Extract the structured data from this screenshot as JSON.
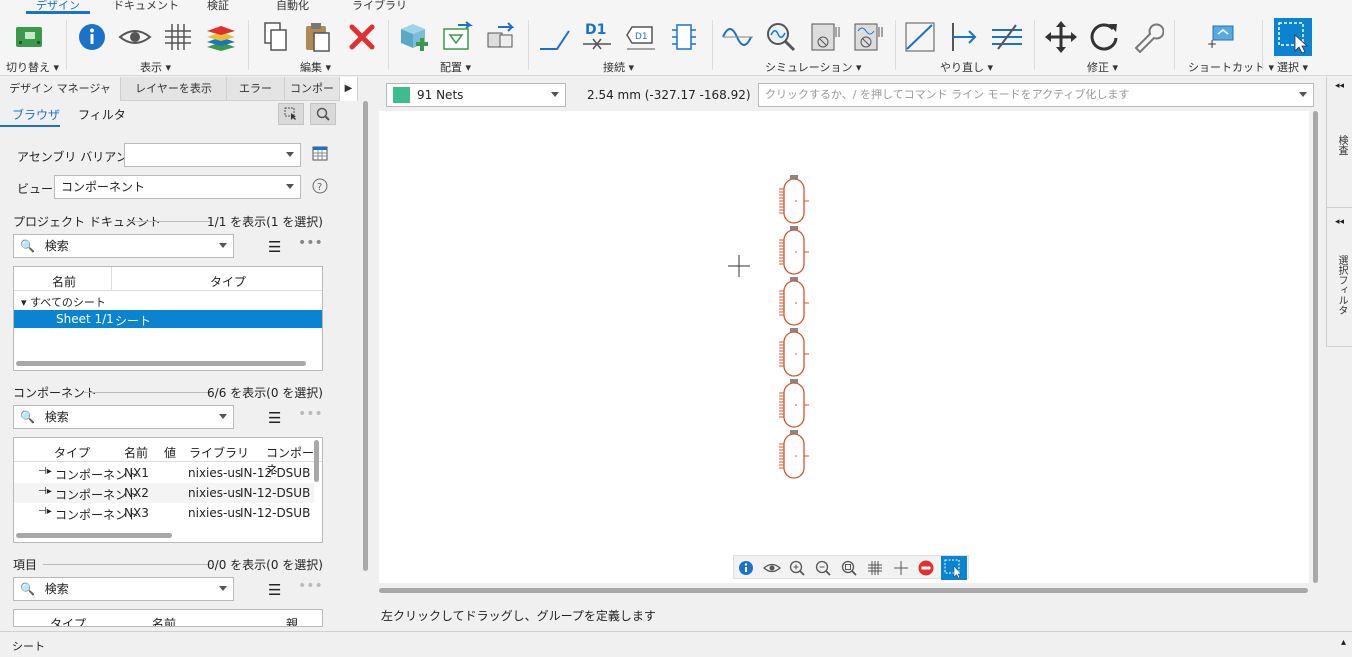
{
  "menu": {
    "tabs": [
      {
        "label": "デザイン",
        "active": true
      },
      {
        "label": "ドキュメント",
        "active": false
      },
      {
        "label": "検証",
        "active": false
      },
      {
        "label": "自動化",
        "active": false
      },
      {
        "label": "ライブラリ",
        "active": false
      }
    ]
  },
  "ribbon": {
    "groups": {
      "switch": "切り替え",
      "view": "表示",
      "edit": "編集",
      "place": "配置",
      "connect": "接続",
      "simulation": "シミュレーション",
      "undo": "やり直し",
      "modify": "修正",
      "shortcut": "ショートカット",
      "select": "選択"
    },
    "net_label": "D1"
  },
  "left_panel": {
    "tabs": [
      "デザイン マネージャ",
      "レイヤーを表示",
      "エラー",
      "コンポー"
    ],
    "subtabs": [
      "ブラウザ",
      "フィルタ"
    ],
    "assembly_variant_label": "アセンブリ バリアント:",
    "assembly_variant_value": "",
    "view_label": "ビュー:",
    "view_value": "コンポーネント",
    "project_docs": {
      "title": "プロジェクト ドキュメント",
      "count": "1/1 を表示(1 を選択)",
      "search_placeholder": "検索",
      "columns": [
        "名前",
        "タイプ"
      ],
      "tree_root": "すべてのシート",
      "rows": [
        {
          "name": "Sheet 1/1",
          "type": "シート"
        }
      ]
    },
    "components": {
      "title": "コンポーネント",
      "count": "6/6 を表示(0 を選択)",
      "search_placeholder": "検索",
      "columns": [
        "タイプ",
        "名前",
        "値",
        "ライブラリ",
        "コンポーネ"
      ],
      "rows": [
        {
          "type": "コンポーネント",
          "name": "NX1",
          "value": "",
          "library": "nixies-us",
          "component": "IN-12-DSUB"
        },
        {
          "type": "コンポーネント",
          "name": "NX2",
          "value": "",
          "library": "nixies-us",
          "component": "IN-12-DSUB"
        },
        {
          "type": "コンポーネント",
          "name": "NX3",
          "value": "",
          "library": "nixies-us",
          "component": "IN-12-DSUB"
        }
      ]
    },
    "items": {
      "title": "項目",
      "count": "0/0 を表示(0 を選択)",
      "search_placeholder": "検索",
      "columns": [
        "タイプ",
        "名前",
        "親"
      ]
    }
  },
  "canvas": {
    "net_selector": "91 Nets",
    "net_color": "#3dbd8d",
    "grid_readout": "2.54 mm (-327.17 -168.92)",
    "command_placeholder": "クリックするか、/ を押してコマンド ライン モードをアクティブ化します",
    "hint": "左クリックしてドラッグし、グループを定義します",
    "component_color": "#d4552a",
    "component_count": 6
  },
  "right_panel": {
    "tabs": [
      "検査",
      "選択フィルタ"
    ]
  },
  "statusbar": {
    "sheet_label": "シート"
  },
  "colors": {
    "accent": "#1a73c8",
    "selection": "#0a84d0",
    "delete_red": "#e03030"
  }
}
